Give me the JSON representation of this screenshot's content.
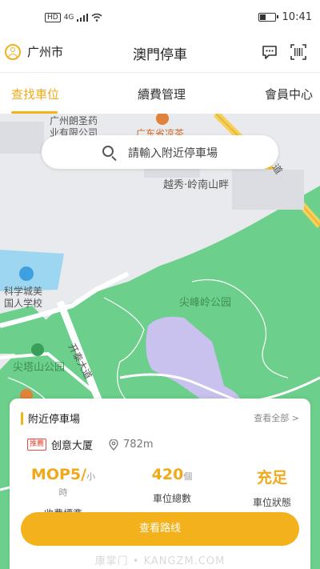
{
  "status_bar": {
    "left_badges": [
      "HD",
      "4G"
    ],
    "time": "10:41"
  },
  "header": {
    "city": "广州市",
    "title": "澳門停車"
  },
  "tabs": [
    {
      "label": "查找車位",
      "active": true
    },
    {
      "label": "續費管理",
      "active": false
    },
    {
      "label": "會員中心",
      "active": false
    }
  ],
  "search": {
    "placeholder": "請輸入附近停車場"
  },
  "map": {
    "labels": [
      "广州朗圣药",
      "业有限公司",
      "广东省凉茶",
      "越秀·岭南山畔",
      "科学城美",
      "国人学校",
      "尖峰岭公园",
      "开泰大道",
      "尖塔山公园",
      "道"
    ]
  },
  "nearby_card": {
    "title": "附近停車場",
    "view_all": "查看全部 >",
    "tag": "推薦",
    "name": "创意大厦",
    "distance": "782m",
    "stats": [
      {
        "value": "MOP5/",
        "unit": "小時",
        "label": "收費標準"
      },
      {
        "value": "420",
        "unit": "個",
        "label": "車位總數"
      },
      {
        "value": "充足",
        "unit": "",
        "label": "車位狀態"
      }
    ],
    "route_button": "查看路线",
    "watermark": "康掌门 • KANGZM.COM"
  },
  "colors": {
    "accent": "#f3b21c",
    "park_green": "#6ccf8b",
    "water": "#9cd6f0",
    "building": "#c9c1ee"
  }
}
